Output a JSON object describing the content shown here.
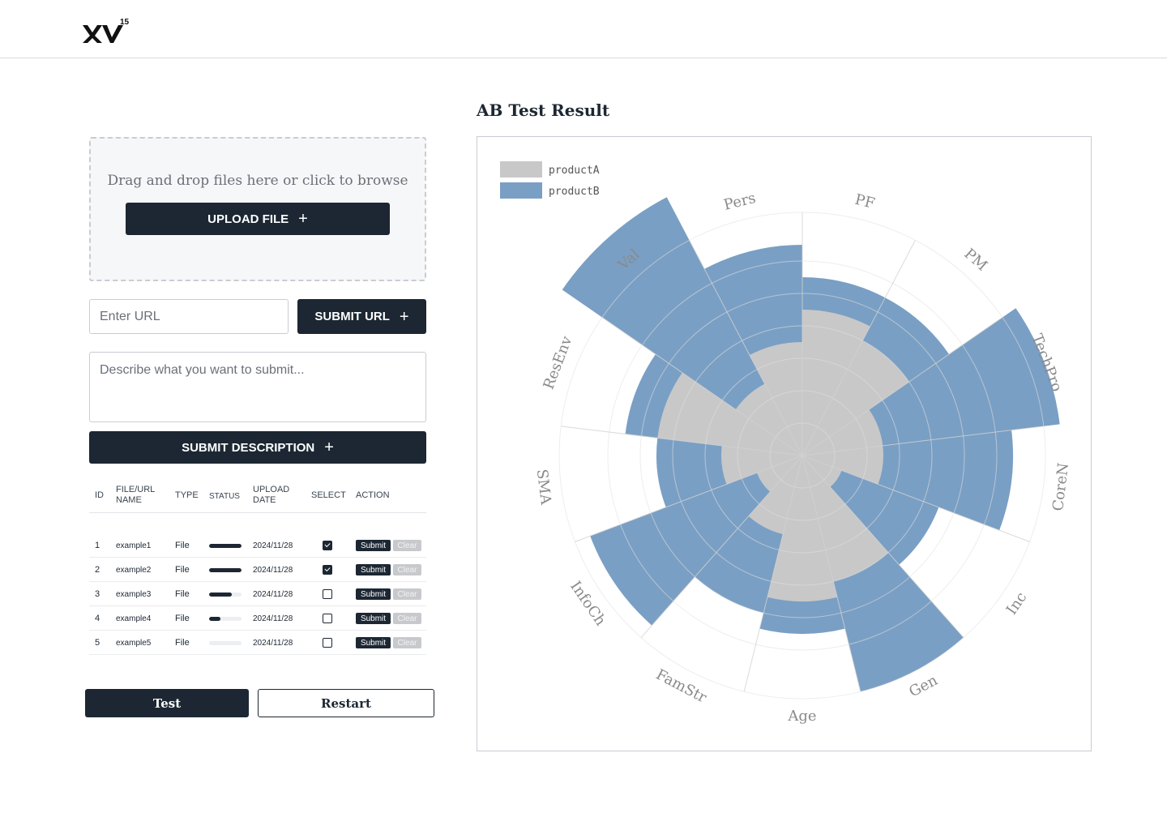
{
  "header": {
    "logo_text": "XV",
    "logo_sup": "15"
  },
  "upload": {
    "dropzone_text": "Drag and drop files here or click to browse",
    "upload_label": "UPLOAD FILE",
    "url_placeholder": "Enter URL",
    "submit_url_label": "SUBMIT URL",
    "description_placeholder": "Describe what you want to submit...",
    "submit_description_label": "SUBMIT DESCRIPTION"
  },
  "table": {
    "headers": {
      "id": "ID",
      "name_line1": "FILE/URL",
      "name_line2": "NAME",
      "type": "TYPE",
      "status": "STATUS",
      "date_line1": "UPLOAD",
      "date_line2": "DATE",
      "select": "SELECT",
      "action": "ACTION"
    },
    "rows": [
      {
        "id": "1",
        "name": "example1",
        "type": "File",
        "progress": 1.0,
        "date": "2024/11/28",
        "selected": true,
        "submit": "Submit",
        "clear": "Clear"
      },
      {
        "id": "2",
        "name": "example2",
        "type": "File",
        "progress": 1.0,
        "date": "2024/11/28",
        "selected": true,
        "submit": "Submit",
        "clear": "Clear"
      },
      {
        "id": "3",
        "name": "example3",
        "type": "File",
        "progress": 0.7,
        "date": "2024/11/28",
        "selected": false,
        "submit": "Submit",
        "clear": "Clear"
      },
      {
        "id": "4",
        "name": "example4",
        "type": "File",
        "progress": 0.35,
        "date": "2024/11/28",
        "selected": false,
        "submit": "Submit",
        "clear": "Clear"
      },
      {
        "id": "5",
        "name": "example5",
        "type": "File",
        "progress": 0.0,
        "date": "2024/11/28",
        "selected": false,
        "submit": "Submit",
        "clear": "Clear"
      }
    ]
  },
  "actions": {
    "test_label": "Test",
    "restart_label": "Restart"
  },
  "chart_title": "AB Test Result",
  "chart_data": {
    "type": "nightingale-rose",
    "categories": [
      "PF",
      "PM",
      "TechPro",
      "CoreN",
      "Inc",
      "Gen",
      "Age",
      "FamStr",
      "InfoCh",
      "SMA",
      "ResEnv",
      "Val",
      "Pers"
    ],
    "series": [
      {
        "name": "productA",
        "color": "#c8c8c8",
        "values": [
          4.5,
          4.0,
          2.5,
          2.5,
          1.3,
          4.0,
          4.5,
          2.5,
          1.5,
          2.5,
          4.5,
          2.5,
          3.5
        ]
      },
      {
        "name": "productB",
        "color": "#7a9fc4",
        "values": [
          5.5,
          5.5,
          8.0,
          6.5,
          4.5,
          7.5,
          5.5,
          5.0,
          7.0,
          4.5,
          5.5,
          9.0,
          6.5
        ]
      }
    ],
    "radius_max": 7.5,
    "ring_count": 7,
    "legend_position": "top-left",
    "grid": true
  }
}
